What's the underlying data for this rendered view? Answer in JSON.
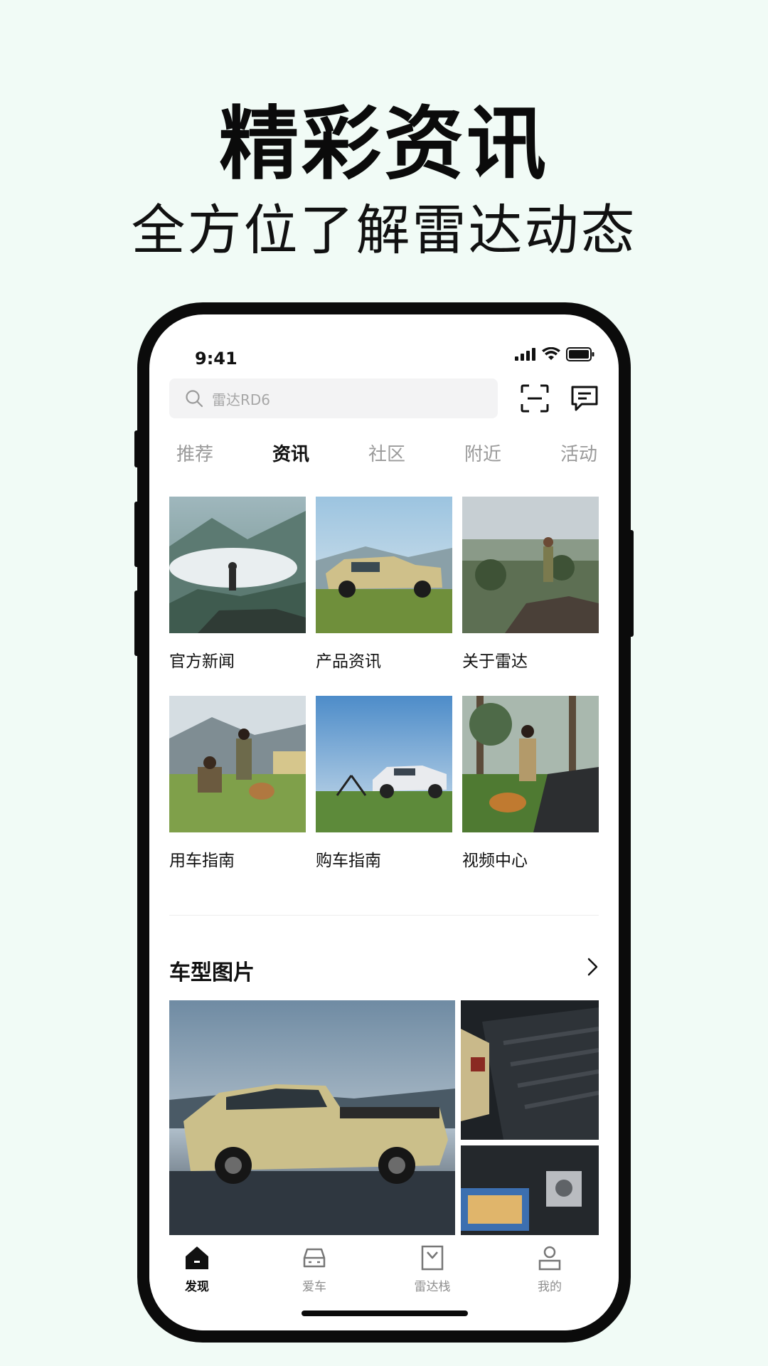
{
  "promo": {
    "title": "精彩资讯",
    "subtitle": "全方位了解雷达动态"
  },
  "status_bar": {
    "time": "9:41"
  },
  "search": {
    "placeholder": "雷达RD6"
  },
  "top_icons": [
    "scan-icon",
    "message-icon"
  ],
  "tabs": [
    {
      "label": "推荐",
      "active": false
    },
    {
      "label": "资讯",
      "active": true
    },
    {
      "label": "社区",
      "active": false
    },
    {
      "label": "附近",
      "active": false
    },
    {
      "label": "活动",
      "active": false
    }
  ],
  "grid": [
    {
      "label": "官方新闻"
    },
    {
      "label": "产品资讯"
    },
    {
      "label": "关于雷达"
    },
    {
      "label": "用车指南"
    },
    {
      "label": "购车指南"
    },
    {
      "label": "视频中心"
    }
  ],
  "section": {
    "title": "车型图片"
  },
  "tabbar": [
    {
      "label": "发现",
      "icon": "home-icon",
      "active": true
    },
    {
      "label": "爱车",
      "icon": "car-icon",
      "active": false
    },
    {
      "label": "雷达栈",
      "icon": "store-icon",
      "active": false
    },
    {
      "label": "我的",
      "icon": "profile-icon",
      "active": false
    }
  ],
  "colors": {
    "background": "#f1fbf6",
    "phone_frame": "#0b0b0b",
    "active_text": "#111111",
    "inactive_text": "#9a9a9a"
  }
}
